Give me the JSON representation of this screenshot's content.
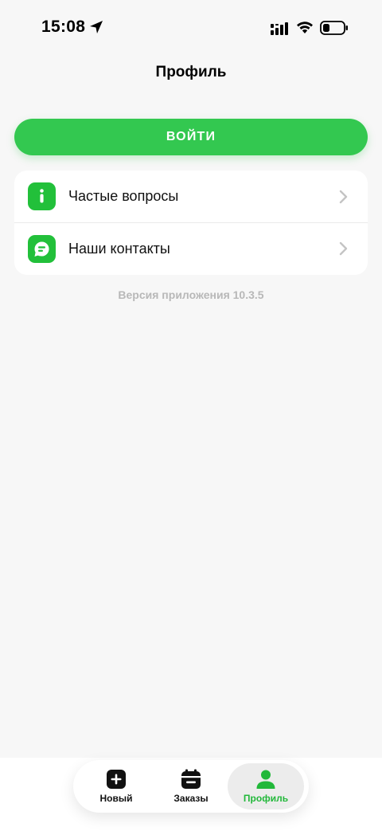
{
  "status_bar": {
    "time": "15:08",
    "icons": [
      "location-arrow-icon",
      "cellular-signal-icon",
      "wifi-icon",
      "battery-icon"
    ]
  },
  "header": {
    "title": "Профиль"
  },
  "login": {
    "label": "ВОЙТИ"
  },
  "menu": {
    "items": [
      {
        "label": "Частые вопросы",
        "icon": "info-icon"
      },
      {
        "label": "Наши контакты",
        "icon": "chat-bubble-icon"
      }
    ]
  },
  "footer": {
    "version": "Версия приложения 10.3.5"
  },
  "tabs": [
    {
      "label": "Новый",
      "icon": "plus-square-icon",
      "active": false
    },
    {
      "label": "Заказы",
      "icon": "calendar-icon",
      "active": false
    },
    {
      "label": "Профиль",
      "icon": "person-icon",
      "active": true
    }
  ],
  "colors": {
    "accent": "#33c850",
    "icon_green": "#22c03a",
    "background": "#f7f7f7",
    "muted_text": "#b8b8b8"
  }
}
